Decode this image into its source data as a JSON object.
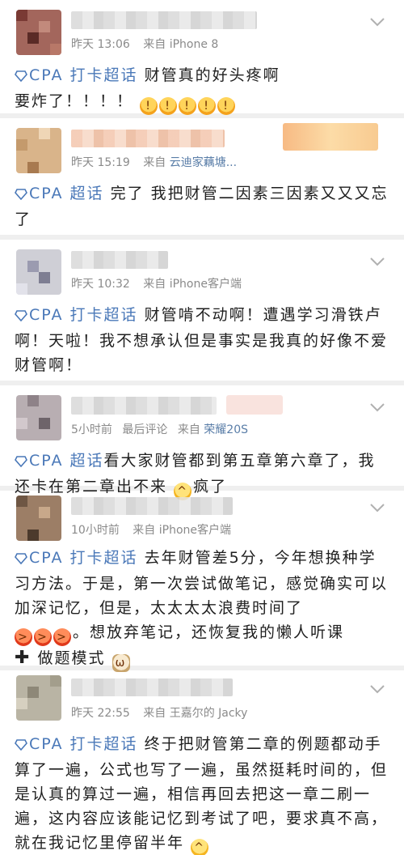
{
  "topic_label": "CPA 打卡超话",
  "topic_label_short": "CPA 超话",
  "colors": {
    "link": "#4a78b8",
    "source": "#5a7ea8",
    "meta": "#8a8a8a",
    "divider": "#efefef"
  },
  "posts": [
    {
      "time": "昨天 13:06",
      "source_prefix": "来自",
      "source": "iPhone 8",
      "topic": "CPA 打卡超话",
      "text_a": "财管真的好头疼啊",
      "text_b": "要炸了！！！！",
      "emojis": [
        "exploding-head",
        "exploding-head",
        "exploding-head",
        "exploding-head",
        "exploding-head"
      ]
    },
    {
      "time": "昨天 15:19",
      "source_prefix": "来自",
      "source": "云迪家藕塘...",
      "topic": "CPA 超话",
      "text_a": "完了 我把财管二因素三因素又又又忘了"
    },
    {
      "time": "昨天 10:32",
      "source_prefix": "来自",
      "source": "iPhone客户端",
      "topic": "CPA 打卡超话",
      "text_a": "财管啃不动啊！遭遇学习滑铁卢啊！天啦！我不想承认但是事实是我真的好像不爱财管啊！"
    },
    {
      "time": "5小时前",
      "extra": "最后评论",
      "source_prefix": "来自",
      "source": "荣耀20S",
      "topic": "CPA 超话",
      "text_a": "看大家财管都到第五章第六章了，我还卡在第二章出不来",
      "text_b": "疯了",
      "emojis": [
        "laughing-crying"
      ]
    },
    {
      "time": "10小时前",
      "source_prefix": "来自",
      "source": "iPhone客户端",
      "topic": "CPA 打卡超话",
      "text_a": "去年财管差5分，今年想换种学习方法。于是，第一次尝试做笔记，感觉确实可以加深记忆，但是，太太太太浪费时间了",
      "text_b": "。想放弃笔记，还恢复我的懒人听课",
      "text_c": "做题模式",
      "emojis": [
        "angry",
        "angry",
        "angry",
        "cat"
      ]
    },
    {
      "time": "昨天 22:55",
      "source_prefix": "来自",
      "source": "王嘉尔的 Jacky",
      "topic": "CPA 打卡超话",
      "text_a": "终于把财管第二章的例题都动手算了一遍，公式也写了一遍，虽然挺耗时间的，但是认真的算过一遍，相信再回去把这一章二刷一遍，这内容应该能记忆到考试了吧，要求真不高，就在我记忆里停留半年",
      "emojis": [
        "laughing-crying"
      ]
    }
  ]
}
